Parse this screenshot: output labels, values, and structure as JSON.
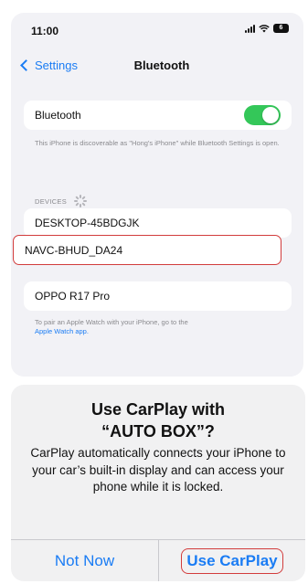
{
  "status_bar": {
    "time": "11:00",
    "battery_label": "6"
  },
  "nav": {
    "back_label": "Settings",
    "title": "Bluetooth"
  },
  "bluetooth_toggle": {
    "label": "Bluetooth",
    "state": "on"
  },
  "discoverable_note": "This iPhone is discoverable as \"Hong's iPhone\" while Bluetooth Settings is open.",
  "devices_header": "DEVICES",
  "devices": [
    {
      "name": "DESKTOP-45BDGJK"
    },
    {
      "name": "NAVC-BHUD_DA24",
      "highlighted": true
    },
    {
      "name": "OPPO R17 Pro"
    }
  ],
  "watch_note": {
    "text": "To pair an Apple Watch with your iPhone, go to the",
    "link": "Apple Watch app."
  },
  "alert": {
    "title_line1": "Use CarPlay with",
    "title_line2": "“AUTO BOX”?",
    "message": "CarPlay automatically connects your iPhone to your car’s built-in display and can access your phone while it is locked.",
    "cancel_label": "Not Now",
    "confirm_label": "Use CarPlay"
  },
  "colors": {
    "accent": "#1a7cf4",
    "toggle_on": "#34c759",
    "highlight": "#d23c3c",
    "grouped_background": "#f2f2f6"
  }
}
